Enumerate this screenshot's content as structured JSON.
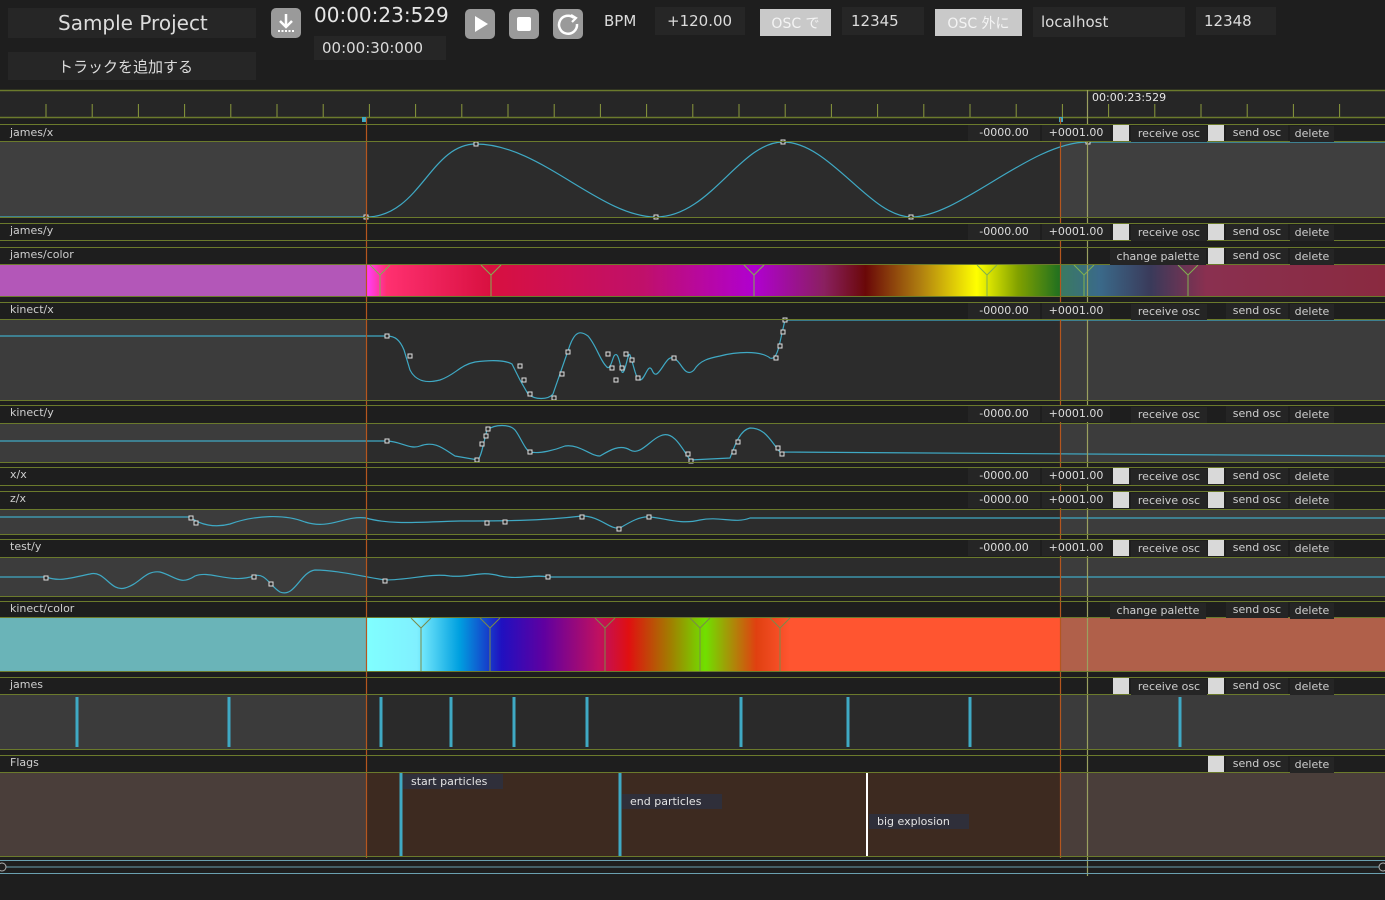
{
  "header": {
    "project_title": "Sample Project",
    "add_track_label": "トラックを追加する",
    "current_time": "00:00:23:529",
    "duration": "00:00:30:000",
    "bpm_label": "BPM",
    "bpm_value": "+120.00",
    "osc_in_label": "OSC で",
    "osc_in_port": "12345",
    "osc_out_label": "OSC 外に",
    "osc_out_host": "localhost",
    "osc_out_port": "12348"
  },
  "ruler": {
    "playhead_time": "00:00:23:529"
  },
  "labels": {
    "receive_osc": "receive osc",
    "send_osc": "send osc",
    "delete": "delete",
    "change_palette": "change palette",
    "min_value": "-0000.00",
    "max_value": "+0001.00"
  },
  "tracks": [
    {
      "name": "james/x",
      "type": "curve"
    },
    {
      "name": "james/y",
      "type": "curve"
    },
    {
      "name": "james/color",
      "type": "color"
    },
    {
      "name": "kinect/x",
      "type": "curve"
    },
    {
      "name": "kinect/y",
      "type": "curve"
    },
    {
      "name": "x/x",
      "type": "curve"
    },
    {
      "name": "z/x",
      "type": "curve"
    },
    {
      "name": "test/y",
      "type": "curve"
    },
    {
      "name": "kinect/color",
      "type": "color"
    },
    {
      "name": "james",
      "type": "bangs"
    },
    {
      "name": "Flags",
      "type": "flags"
    }
  ],
  "flags": [
    "start particles",
    "end particles",
    "big explosion"
  ],
  "colors": {
    "accent_line": "#6b7a2c",
    "curve": "#3fa9c4",
    "playhead": "#9aa060",
    "in_out_marker": "#b5561e",
    "bang": "#3fa9c4"
  }
}
